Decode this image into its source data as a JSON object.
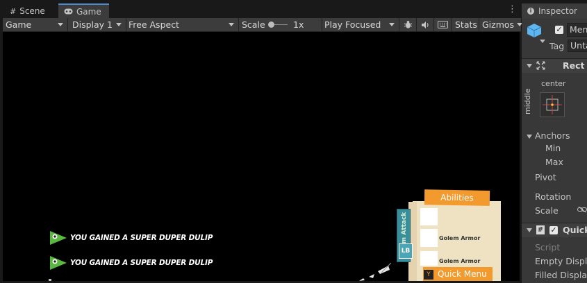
{
  "tabs": [
    {
      "label": "Scene",
      "icon": "hash-icon"
    },
    {
      "label": "Game",
      "icon": "gamepad-icon"
    }
  ],
  "toolbar": {
    "display_mode": "Game",
    "display": "Display 1",
    "aspect": "Free Aspect",
    "scale_label": "Scale",
    "scale_value": "1x",
    "play_mode": "Play Focused",
    "stats_label": "Stats",
    "gizmos_label": "Gizmos"
  },
  "game": {
    "notifications": [
      "YOU GAINED A SUPER DUPER DULIP",
      "YOU GAINED A SUPER DUPER DULIP"
    ],
    "abilities_label": "Abilities",
    "team_attack_label": "Team Attack",
    "lb_label": "LB",
    "item_labels": [
      "Golem Armor",
      "Golem Armor"
    ],
    "quick_menu_label": "Quick Menu",
    "colors": {
      "accent_orange": "#f29a2e",
      "panel": "#efe2c2",
      "teal": "#3a8f9c",
      "green": "#5ab840"
    }
  },
  "inspector": {
    "tab_label": "Inspector",
    "object_name": "Men",
    "tag_label": "Tag",
    "tag_value": "Unta",
    "rect_transform": "Rect T",
    "anchor_h": "center",
    "anchor_v": "middle",
    "anchors_label": "Anchors",
    "min_label": "Min",
    "max_label": "Max",
    "pivot_label": "Pivot",
    "rotation_label": "Rotation",
    "scale_label": "Scale",
    "component_label": "Quick",
    "script_label": "Script",
    "empty_display_label": "Empty Display",
    "filled_display_label": "Filled Display"
  }
}
